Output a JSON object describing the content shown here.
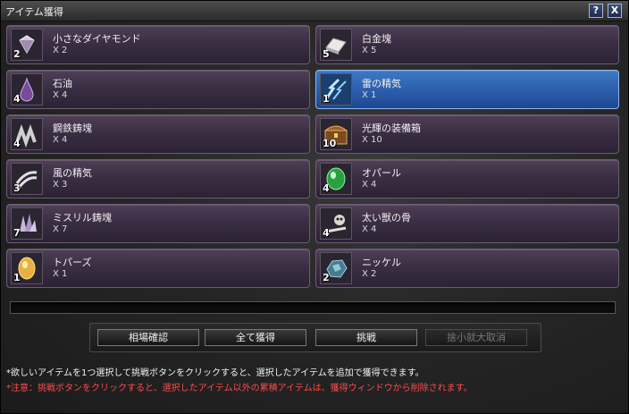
{
  "window": {
    "title": "アイテム獲得",
    "help_label": "?",
    "close_label": "X"
  },
  "items": [
    {
      "name": "小さなダイヤモンド",
      "count": "X 2",
      "qty": "2",
      "icon": "diamond-icon",
      "selected": false
    },
    {
      "name": "白金塊",
      "count": "X 5",
      "qty": "5",
      "icon": "platinum-ingot-icon",
      "selected": false
    },
    {
      "name": "石油",
      "count": "X 4",
      "qty": "4",
      "icon": "oil-drop-icon",
      "selected": false
    },
    {
      "name": "雷の精気",
      "count": "X 1",
      "qty": "1",
      "icon": "lightning-essence-icon",
      "selected": true
    },
    {
      "name": "鋼鉄鋳塊",
      "count": "X 4",
      "qty": "4",
      "icon": "steel-ingot-icon",
      "selected": false
    },
    {
      "name": "光輝の装備箱",
      "count": "X 10",
      "qty": "10",
      "icon": "treasure-chest-icon",
      "selected": false
    },
    {
      "name": "風の精気",
      "count": "X 3",
      "qty": "3",
      "icon": "wind-essence-icon",
      "selected": false
    },
    {
      "name": "オパール",
      "count": "X 4",
      "qty": "4",
      "icon": "opal-gem-icon",
      "selected": false
    },
    {
      "name": "ミスリル鋳塊",
      "count": "X 7",
      "qty": "7",
      "icon": "mithril-crystal-icon",
      "selected": false
    },
    {
      "name": "太い獣の骨",
      "count": "X 4",
      "qty": "4",
      "icon": "beast-bone-icon",
      "selected": false
    },
    {
      "name": "トパーズ",
      "count": "X 1",
      "qty": "1",
      "icon": "topaz-gem-icon",
      "selected": false
    },
    {
      "name": "ニッケル",
      "count": "X 2",
      "qty": "2",
      "icon": "nickel-ore-icon",
      "selected": false
    }
  ],
  "buttons": {
    "market_check": "相場確認",
    "acquire_all": "全て獲得",
    "challenge": "挑戦",
    "abandon": "捨小就大取消"
  },
  "notes": {
    "info": "*欲しいアイテムを1つ選択して挑戦ボタンをクリックすると、選択したアイテムを追加で獲得できます。",
    "warning": "*注意：挑戦ボタンをクリックすると、選択したアイテム以外の累積アイテムは、獲得ウィンドウから削除されます。"
  },
  "colors": {
    "selected": "#2d5fae",
    "card": "#3b2e44",
    "warning": "#ff4a4a"
  }
}
